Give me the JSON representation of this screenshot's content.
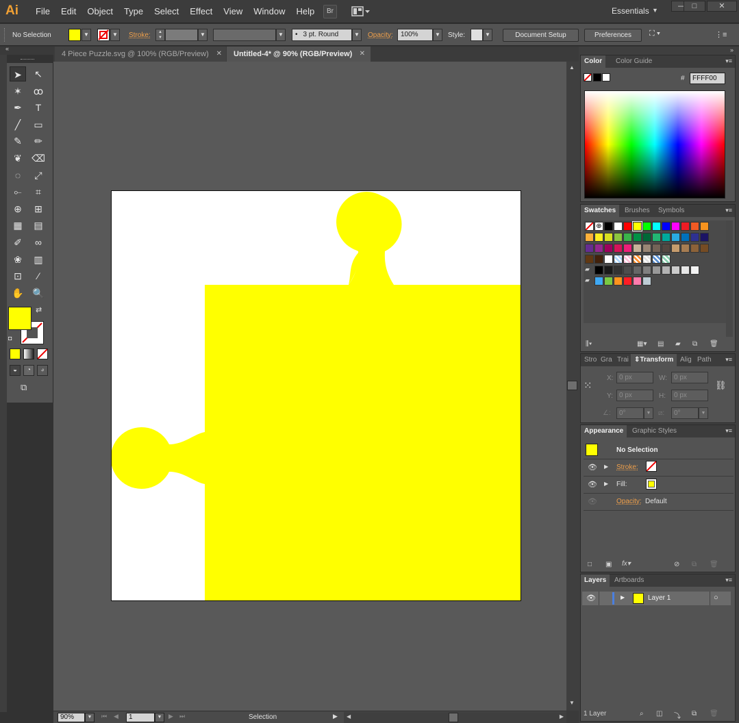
{
  "app": {
    "logo": "Ai",
    "bridge_label": "Br",
    "workspace": "Essentials"
  },
  "menu": [
    "File",
    "Edit",
    "Object",
    "Type",
    "Select",
    "Effect",
    "View",
    "Window",
    "Help"
  ],
  "window_controls": {
    "minimize": "—",
    "maximize": "□",
    "close": "✕"
  },
  "control_bar": {
    "selection": "No Selection",
    "stroke_label": "Stroke:",
    "brush": "3 pt. Round",
    "opacity_label": "Opacity:",
    "opacity_value": "100%",
    "style_label": "Style:",
    "document_setup": "Document Setup",
    "preferences": "Preferences"
  },
  "tabs": [
    {
      "label": "4 Piece Puzzle.svg @ 100% (RGB/Preview)",
      "active": false
    },
    {
      "label": "Untitled-4* @ 90% (RGB/Preview)",
      "active": true
    }
  ],
  "tools": [
    [
      "selection-tool",
      "direct-selection-tool"
    ],
    [
      "magic-wand-tool",
      "lasso-tool"
    ],
    [
      "pen-tool",
      "type-tool"
    ],
    [
      "line-segment-tool",
      "rectangle-tool"
    ],
    [
      "paintbrush-tool",
      "pencil-tool"
    ],
    [
      "blob-brush-tool",
      "eraser-tool"
    ],
    [
      "rotate-tool",
      "scale-tool"
    ],
    [
      "width-tool",
      "free-transform-tool"
    ],
    [
      "shape-builder-tool",
      "perspective-grid-tool"
    ],
    [
      "mesh-tool",
      "gradient-tool"
    ],
    [
      "eyedropper-tool",
      "blend-tool"
    ],
    [
      "symbol-sprayer-tool",
      "column-graph-tool"
    ],
    [
      "artboard-tool",
      "slice-tool"
    ],
    [
      "hand-tool",
      "zoom-tool"
    ]
  ],
  "tool_glyphs": [
    "➤",
    "↖",
    "✶",
    "ꝏ",
    "✒",
    "T",
    "╱",
    "▭",
    "✎",
    "✏",
    "❦",
    "⌫",
    "◌",
    "⤢",
    "⟜",
    "⌗",
    "⊕",
    "⊞",
    "▦",
    "▤",
    "✐",
    "∞",
    "❀",
    "▥",
    "⊡",
    "⁄",
    "✋",
    "🔍"
  ],
  "colors": {
    "fill": "#FFFF00",
    "accent_orange": "#F0A04B"
  },
  "status": {
    "zoom": "90%",
    "artboard": "1",
    "tool": "Selection"
  },
  "color_panel": {
    "tabs": [
      "Color",
      "Color Guide"
    ],
    "hash": "#",
    "hex": "FFFF00"
  },
  "swatches_panel": {
    "tabs": [
      "Swatches",
      "Brushes",
      "Symbols"
    ],
    "rows": [
      [
        "none",
        "registration",
        "#000000",
        "#FFFFFF",
        "#FF0000",
        "#FFFF00",
        "#00FF00",
        "#00FFFF",
        "#0000FF",
        "#FF00FF",
        "#ED1C24",
        "#F15A24",
        "#F7931E"
      ],
      [
        "#FBB03B",
        "#FCEE21",
        "#D9E021",
        "#8CC63F",
        "#39B54A",
        "#009245",
        "#006837",
        "#22B573",
        "#00A99D",
        "#29ABE2",
        "#0071BC",
        "#2E3192",
        "#1B1464"
      ],
      [
        "#662D91",
        "#93278F",
        "#9E005D",
        "#D4145A",
        "#ED1E79",
        "#C7B299",
        "#998675",
        "#736357",
        "#534741",
        "#C69C6D",
        "#A67C52",
        "#8C6239",
        "#754C24"
      ],
      [
        "#603813",
        "#42210B"
      ],
      [
        "#000000",
        "#1A1A1A",
        "#333333",
        "#4D4D4D",
        "#666666",
        "#808080",
        "#999999",
        "#B3B3B3",
        "#CCCCCC",
        "#E6E6E6",
        "#F2F2F2"
      ],
      [
        "#3FA9F5",
        "#7AC943",
        "#FF931E",
        "#FF1D25",
        "#FF7BAC",
        "#BDCCD4"
      ]
    ]
  },
  "transform_panel": {
    "tabs": [
      "Stro",
      "Gra",
      "Trai",
      "Transform",
      "Alig",
      "Path"
    ],
    "x_label": "X:",
    "x": "0 px",
    "y_label": "Y:",
    "y": "0 px",
    "w_label": "W:",
    "w": "0 px",
    "h_label": "H:",
    "h": "0 px",
    "rotate": "0°",
    "shear": "0°"
  },
  "appearance_panel": {
    "tabs": [
      "Appearance",
      "Graphic Styles"
    ],
    "title": "No Selection",
    "stroke_label": "Stroke:",
    "fill_label": "Fill:",
    "opacity_label": "Opacity:",
    "opacity_value": "Default"
  },
  "layers_panel": {
    "tabs": [
      "Layers",
      "Artboards"
    ],
    "layer_name": "Layer 1",
    "count": "1 Layer"
  }
}
